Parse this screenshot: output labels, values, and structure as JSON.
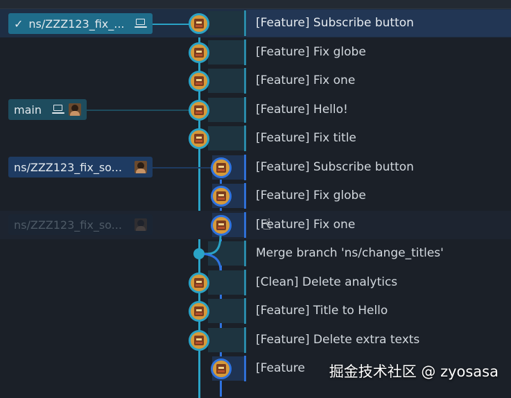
{
  "commits": [
    {
      "message": "[Feature] Subscribe button"
    },
    {
      "message": "[Feature] Fix globe"
    },
    {
      "message": "[Feature] Fix one"
    },
    {
      "message": "[Feature] Hello!"
    },
    {
      "message": "[Feature] Fix title"
    },
    {
      "message": "[Feature] Subscribe button"
    },
    {
      "message": "[Feature] Fix globe"
    },
    {
      "message": "[Feature] Fix one"
    },
    {
      "message": "Merge branch 'ns/change_titles'"
    },
    {
      "message": "[Clean] Delete analytics"
    },
    {
      "message": "[Feature] Title to Hello"
    },
    {
      "message": "[Feature] Delete extra texts"
    },
    {
      "message": "[Feature"
    }
  ],
  "branches": {
    "current": {
      "label": "ns/ZZZ123_fix_...",
      "check": "✓",
      "icon": "laptop-icon"
    },
    "main": {
      "label": "main",
      "icons": [
        "laptop-icon",
        "avatar"
      ]
    },
    "remote": {
      "label": "ns/ZZZ123_fix_so...",
      "icon": "avatar"
    },
    "ghost": {
      "label": "ns/ZZZ123_fix_so...",
      "icon": "avatar"
    }
  },
  "watermark": "掘金技术社区 @ zyosasa",
  "colors": {
    "teal_lane": "#2aa3c6",
    "blue_lane": "#2f73e0",
    "active_badge": "#1f6c8a",
    "row_highlight": "#223654"
  }
}
